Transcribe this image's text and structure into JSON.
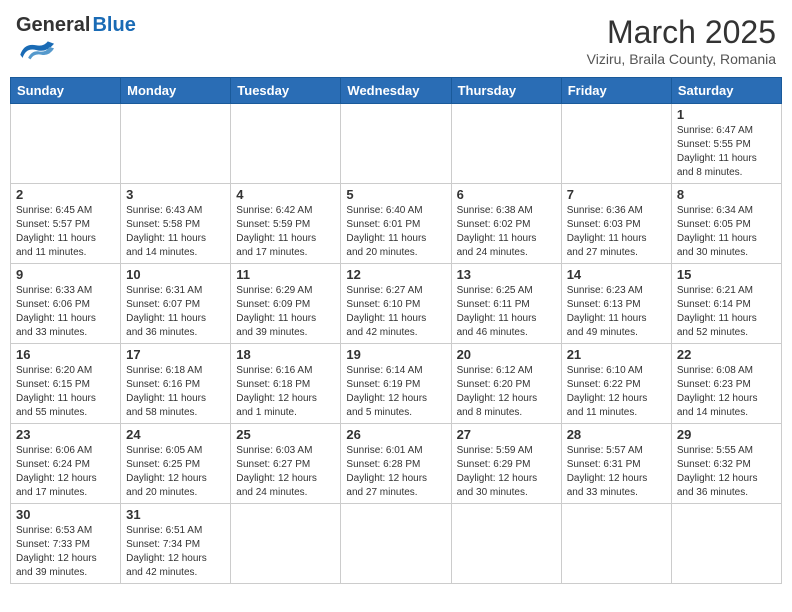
{
  "header": {
    "logo_general": "General",
    "logo_blue": "Blue",
    "month_title": "March 2025",
    "subtitle": "Viziru, Braila County, Romania"
  },
  "weekdays": [
    "Sunday",
    "Monday",
    "Tuesday",
    "Wednesday",
    "Thursday",
    "Friday",
    "Saturday"
  ],
  "weeks": [
    [
      {
        "day": "",
        "info": ""
      },
      {
        "day": "",
        "info": ""
      },
      {
        "day": "",
        "info": ""
      },
      {
        "day": "",
        "info": ""
      },
      {
        "day": "",
        "info": ""
      },
      {
        "day": "",
        "info": ""
      },
      {
        "day": "1",
        "info": "Sunrise: 6:47 AM\nSunset: 5:55 PM\nDaylight: 11 hours\nand 8 minutes."
      }
    ],
    [
      {
        "day": "2",
        "info": "Sunrise: 6:45 AM\nSunset: 5:57 PM\nDaylight: 11 hours\nand 11 minutes."
      },
      {
        "day": "3",
        "info": "Sunrise: 6:43 AM\nSunset: 5:58 PM\nDaylight: 11 hours\nand 14 minutes."
      },
      {
        "day": "4",
        "info": "Sunrise: 6:42 AM\nSunset: 5:59 PM\nDaylight: 11 hours\nand 17 minutes."
      },
      {
        "day": "5",
        "info": "Sunrise: 6:40 AM\nSunset: 6:01 PM\nDaylight: 11 hours\nand 20 minutes."
      },
      {
        "day": "6",
        "info": "Sunrise: 6:38 AM\nSunset: 6:02 PM\nDaylight: 11 hours\nand 24 minutes."
      },
      {
        "day": "7",
        "info": "Sunrise: 6:36 AM\nSunset: 6:03 PM\nDaylight: 11 hours\nand 27 minutes."
      },
      {
        "day": "8",
        "info": "Sunrise: 6:34 AM\nSunset: 6:05 PM\nDaylight: 11 hours\nand 30 minutes."
      }
    ],
    [
      {
        "day": "9",
        "info": "Sunrise: 6:33 AM\nSunset: 6:06 PM\nDaylight: 11 hours\nand 33 minutes."
      },
      {
        "day": "10",
        "info": "Sunrise: 6:31 AM\nSunset: 6:07 PM\nDaylight: 11 hours\nand 36 minutes."
      },
      {
        "day": "11",
        "info": "Sunrise: 6:29 AM\nSunset: 6:09 PM\nDaylight: 11 hours\nand 39 minutes."
      },
      {
        "day": "12",
        "info": "Sunrise: 6:27 AM\nSunset: 6:10 PM\nDaylight: 11 hours\nand 42 minutes."
      },
      {
        "day": "13",
        "info": "Sunrise: 6:25 AM\nSunset: 6:11 PM\nDaylight: 11 hours\nand 46 minutes."
      },
      {
        "day": "14",
        "info": "Sunrise: 6:23 AM\nSunset: 6:13 PM\nDaylight: 11 hours\nand 49 minutes."
      },
      {
        "day": "15",
        "info": "Sunrise: 6:21 AM\nSunset: 6:14 PM\nDaylight: 11 hours\nand 52 minutes."
      }
    ],
    [
      {
        "day": "16",
        "info": "Sunrise: 6:20 AM\nSunset: 6:15 PM\nDaylight: 11 hours\nand 55 minutes."
      },
      {
        "day": "17",
        "info": "Sunrise: 6:18 AM\nSunset: 6:16 PM\nDaylight: 11 hours\nand 58 minutes."
      },
      {
        "day": "18",
        "info": "Sunrise: 6:16 AM\nSunset: 6:18 PM\nDaylight: 12 hours\nand 1 minute."
      },
      {
        "day": "19",
        "info": "Sunrise: 6:14 AM\nSunset: 6:19 PM\nDaylight: 12 hours\nand 5 minutes."
      },
      {
        "day": "20",
        "info": "Sunrise: 6:12 AM\nSunset: 6:20 PM\nDaylight: 12 hours\nand 8 minutes."
      },
      {
        "day": "21",
        "info": "Sunrise: 6:10 AM\nSunset: 6:22 PM\nDaylight: 12 hours\nand 11 minutes."
      },
      {
        "day": "22",
        "info": "Sunrise: 6:08 AM\nSunset: 6:23 PM\nDaylight: 12 hours\nand 14 minutes."
      }
    ],
    [
      {
        "day": "23",
        "info": "Sunrise: 6:06 AM\nSunset: 6:24 PM\nDaylight: 12 hours\nand 17 minutes."
      },
      {
        "day": "24",
        "info": "Sunrise: 6:05 AM\nSunset: 6:25 PM\nDaylight: 12 hours\nand 20 minutes."
      },
      {
        "day": "25",
        "info": "Sunrise: 6:03 AM\nSunset: 6:27 PM\nDaylight: 12 hours\nand 24 minutes."
      },
      {
        "day": "26",
        "info": "Sunrise: 6:01 AM\nSunset: 6:28 PM\nDaylight: 12 hours\nand 27 minutes."
      },
      {
        "day": "27",
        "info": "Sunrise: 5:59 AM\nSunset: 6:29 PM\nDaylight: 12 hours\nand 30 minutes."
      },
      {
        "day": "28",
        "info": "Sunrise: 5:57 AM\nSunset: 6:31 PM\nDaylight: 12 hours\nand 33 minutes."
      },
      {
        "day": "29",
        "info": "Sunrise: 5:55 AM\nSunset: 6:32 PM\nDaylight: 12 hours\nand 36 minutes."
      }
    ],
    [
      {
        "day": "30",
        "info": "Sunrise: 6:53 AM\nSunset: 7:33 PM\nDaylight: 12 hours\nand 39 minutes."
      },
      {
        "day": "31",
        "info": "Sunrise: 6:51 AM\nSunset: 7:34 PM\nDaylight: 12 hours\nand 42 minutes."
      },
      {
        "day": "",
        "info": ""
      },
      {
        "day": "",
        "info": ""
      },
      {
        "day": "",
        "info": ""
      },
      {
        "day": "",
        "info": ""
      },
      {
        "day": "",
        "info": ""
      }
    ]
  ]
}
